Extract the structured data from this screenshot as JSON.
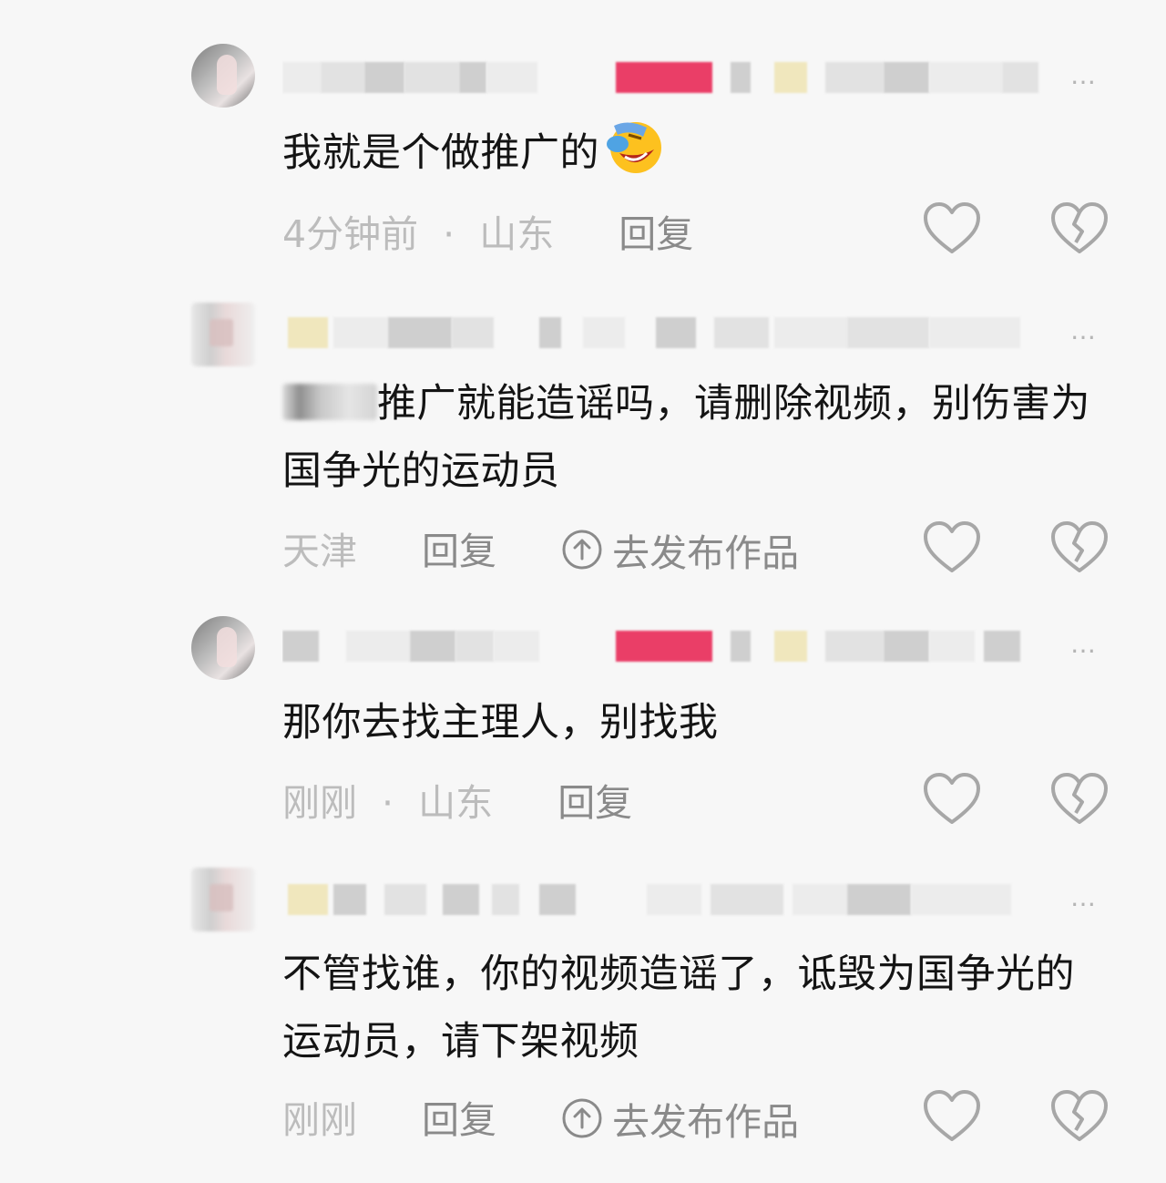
{
  "comments": [
    {
      "text": "我就是个做推广的",
      "emoji": "laughing-tears-emoji",
      "time": "4分钟前",
      "dot": "·",
      "location": "山东",
      "reply_label": "回复"
    },
    {
      "text_prefix_redacted": true,
      "text": "推广就能造谣吗，请删除视频，别伤害为国争光的运动员",
      "location": "天津",
      "reply_label": "回复",
      "publish_label": "去发布作品"
    },
    {
      "text": "那你去找主理人，别找我",
      "time": "刚刚",
      "dot": "·",
      "location": "山东",
      "reply_label": "回复"
    },
    {
      "text": "不管找谁，你的视频造谣了，诋毁为国争光的运动员，请下架视频",
      "time": "刚刚",
      "reply_label": "回复",
      "publish_label": "去发布作品"
    }
  ],
  "ellipsis": "…",
  "colors": {
    "background": "#f7f7f7",
    "text": "#141414",
    "meta": "#bcbcbc",
    "reply": "#8a8a8a",
    "icon_stroke": "#a7a7a7"
  },
  "icons": [
    "like-heart-icon",
    "dislike-broken-heart-icon",
    "publish-upload-icon"
  ]
}
